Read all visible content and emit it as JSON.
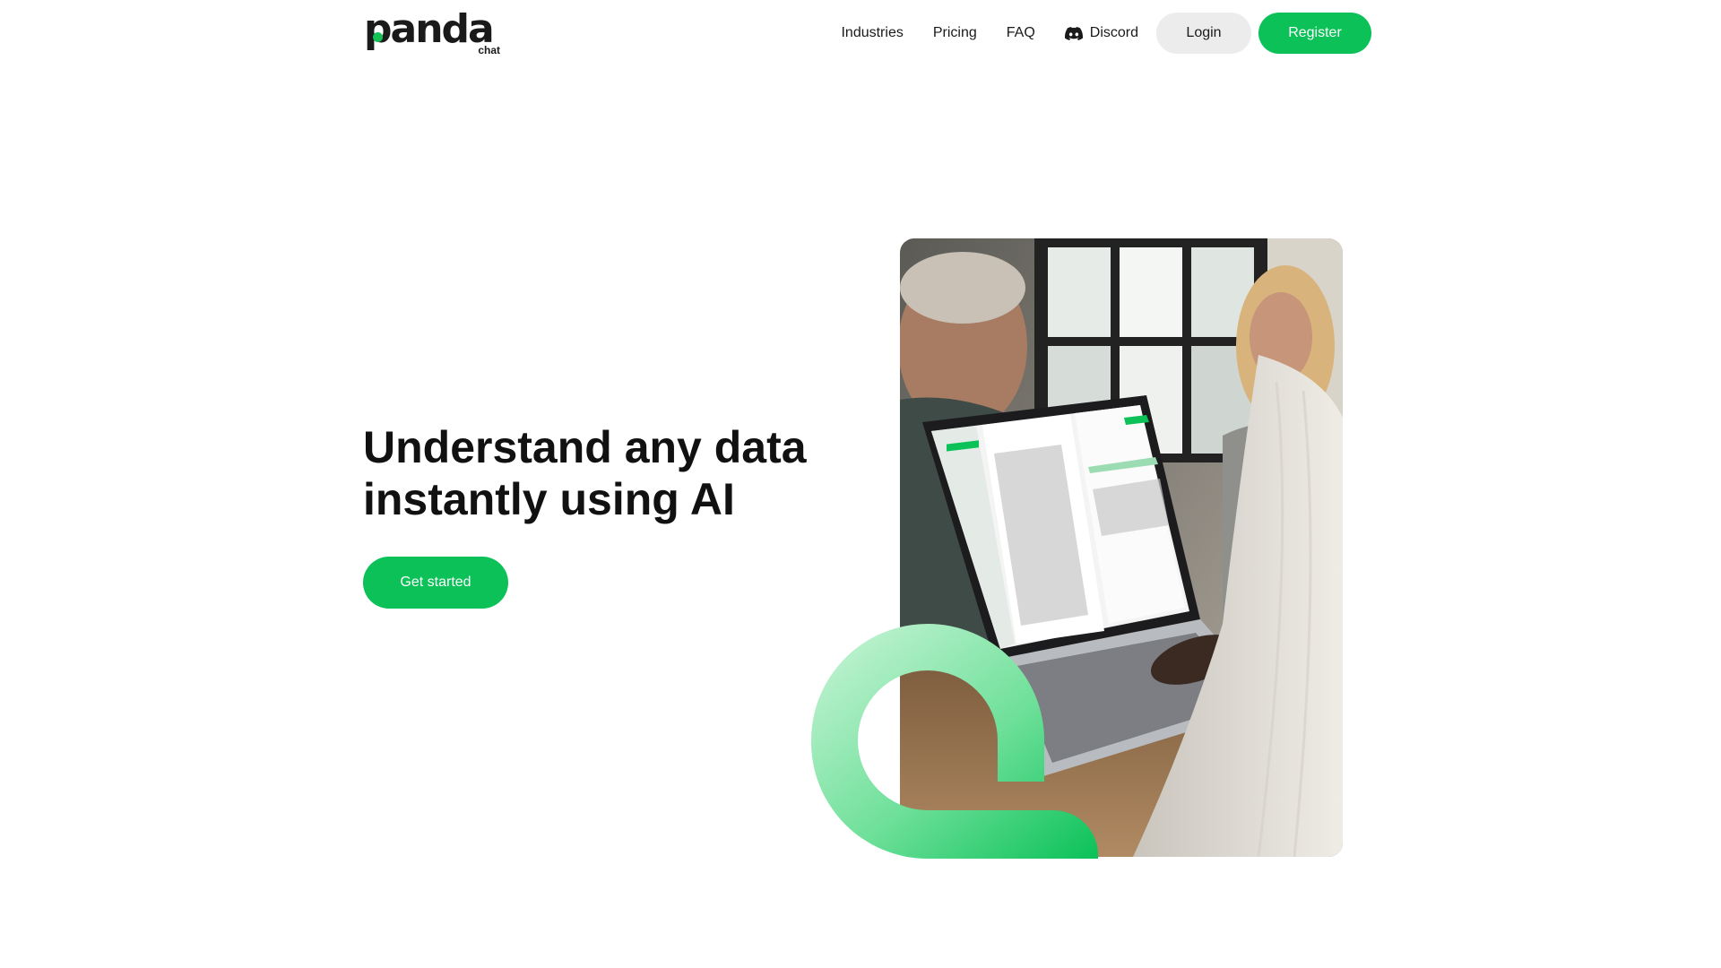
{
  "brand": {
    "name": "panda",
    "sub": "chat",
    "accent_color": "#0bc158"
  },
  "nav": {
    "links": [
      {
        "label": "Industries"
      },
      {
        "label": "Pricing"
      },
      {
        "label": "FAQ"
      },
      {
        "label": "Discord",
        "icon": "discord-icon"
      }
    ],
    "login_label": "Login",
    "register_label": "Register"
  },
  "hero": {
    "title_line1": "Understand any data",
    "title_line2": "instantly using AI",
    "cta_label": "Get started",
    "image_alt": "People collaborating around a laptop showing the panda chat app"
  }
}
